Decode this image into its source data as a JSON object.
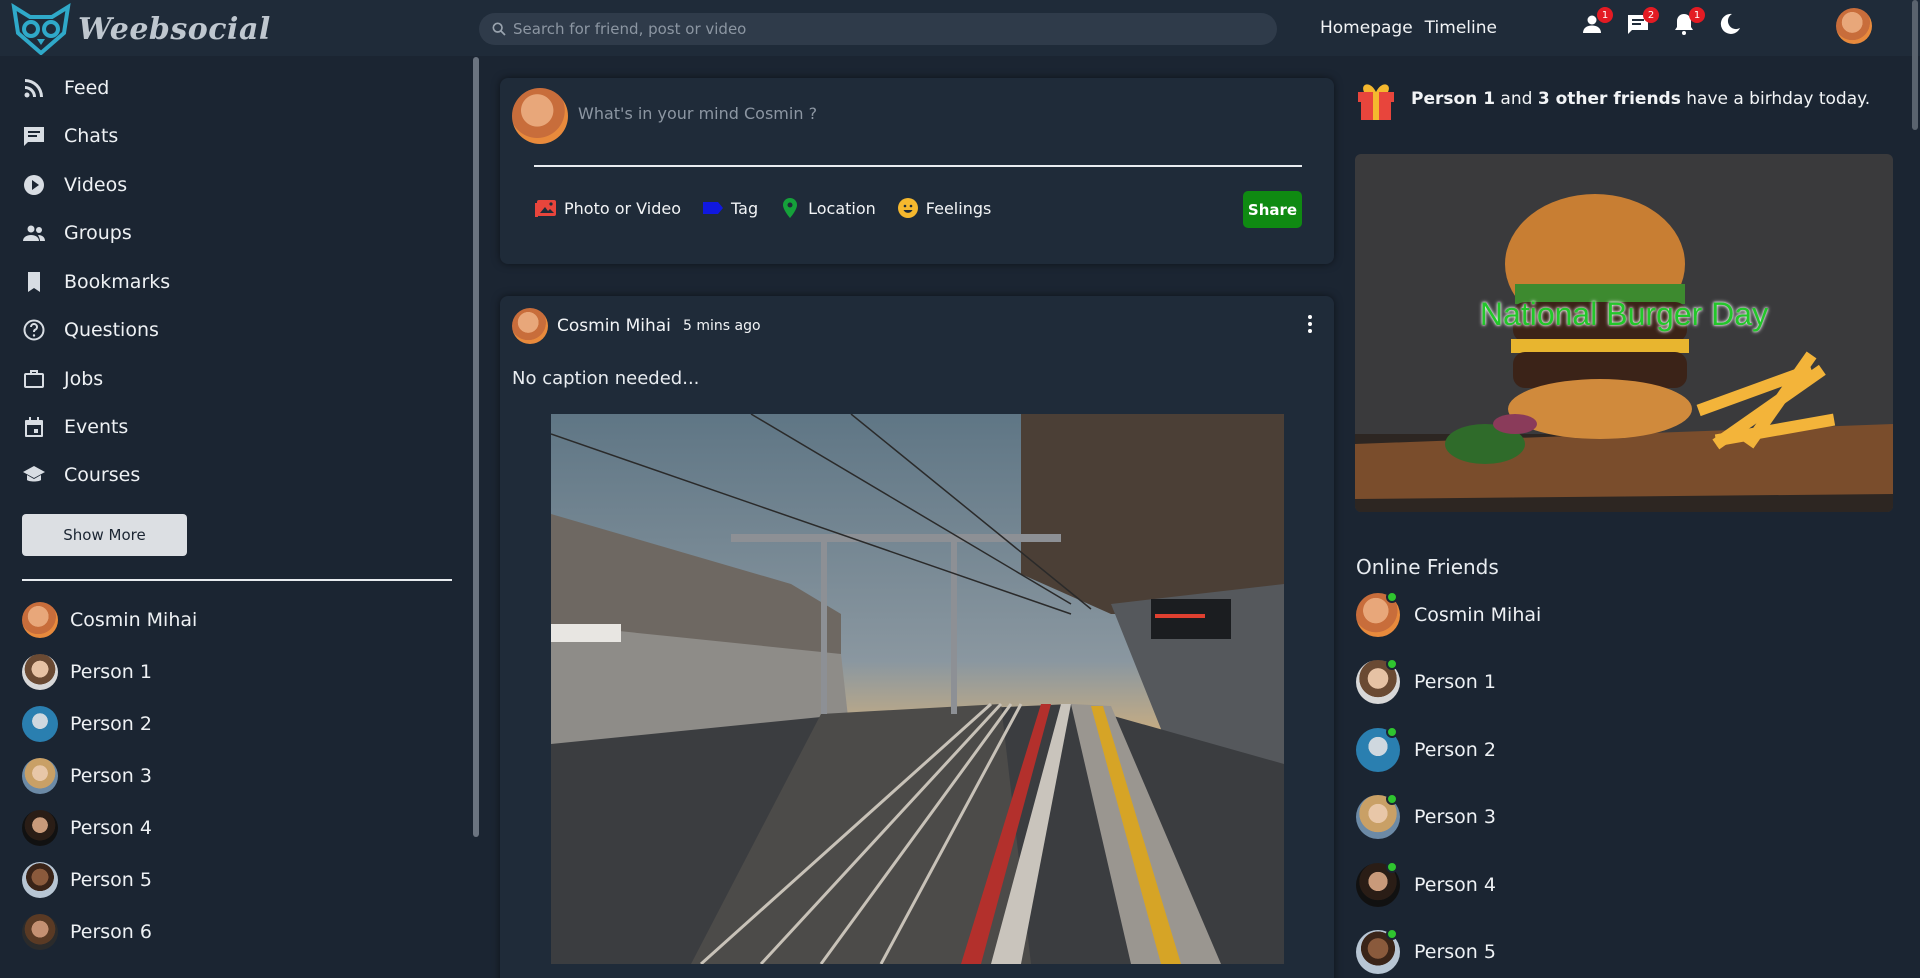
{
  "app": {
    "logo_text": "Weebsocial"
  },
  "search": {
    "placeholder": "Search for friend, post or video"
  },
  "nav": {
    "links": [
      "Homepage",
      "Timeline"
    ],
    "icons": [
      {
        "name": "person-icon",
        "badge": "1"
      },
      {
        "name": "chat-icon",
        "badge": "2"
      },
      {
        "name": "bell-icon",
        "badge": "1"
      },
      {
        "name": "moon-icon",
        "badge": ""
      }
    ]
  },
  "sidebar": {
    "menu": [
      {
        "label": "Feed",
        "icon": "rss-icon"
      },
      {
        "label": "Chats",
        "icon": "chat-icon"
      },
      {
        "label": "Videos",
        "icon": "play-circle-icon"
      },
      {
        "label": "Groups",
        "icon": "group-icon"
      },
      {
        "label": "Bookmarks",
        "icon": "bookmark-icon"
      },
      {
        "label": "Questions",
        "icon": "help-circle-icon"
      },
      {
        "label": "Jobs",
        "icon": "briefcase-icon"
      },
      {
        "label": "Events",
        "icon": "calendar-icon"
      },
      {
        "label": "Courses",
        "icon": "school-icon"
      }
    ],
    "show_more": "Show More",
    "friends": [
      "Cosmin Mihai",
      "Person 1",
      "Person 2",
      "Person 3",
      "Person 4",
      "Person 5",
      "Person 6"
    ]
  },
  "composer": {
    "placeholder": "What's in your mind Cosmin ?",
    "options": [
      "Photo or Video",
      "Tag",
      "Location",
      "Feelings"
    ],
    "share": "Share",
    "colors": {
      "photo": "#e8453c",
      "tag": "#1018e0",
      "location": "#15a13a",
      "feelings": "#f5b82e",
      "share_bg": "#0f8a12"
    }
  },
  "post": {
    "author": "Cosmin Mihai",
    "time": "5 mins ago",
    "caption": "No caption needed..."
  },
  "right": {
    "birthday": {
      "name": "Person 1",
      "middle": " and ",
      "others": "3 other friends",
      "tail": " have a birhday today."
    },
    "ad_text": "National Burger Day",
    "online_title": "Online Friends",
    "online": [
      "Cosmin Mihai",
      "Person 1",
      "Person 2",
      "Person 3",
      "Person 4",
      "Person 5"
    ]
  }
}
